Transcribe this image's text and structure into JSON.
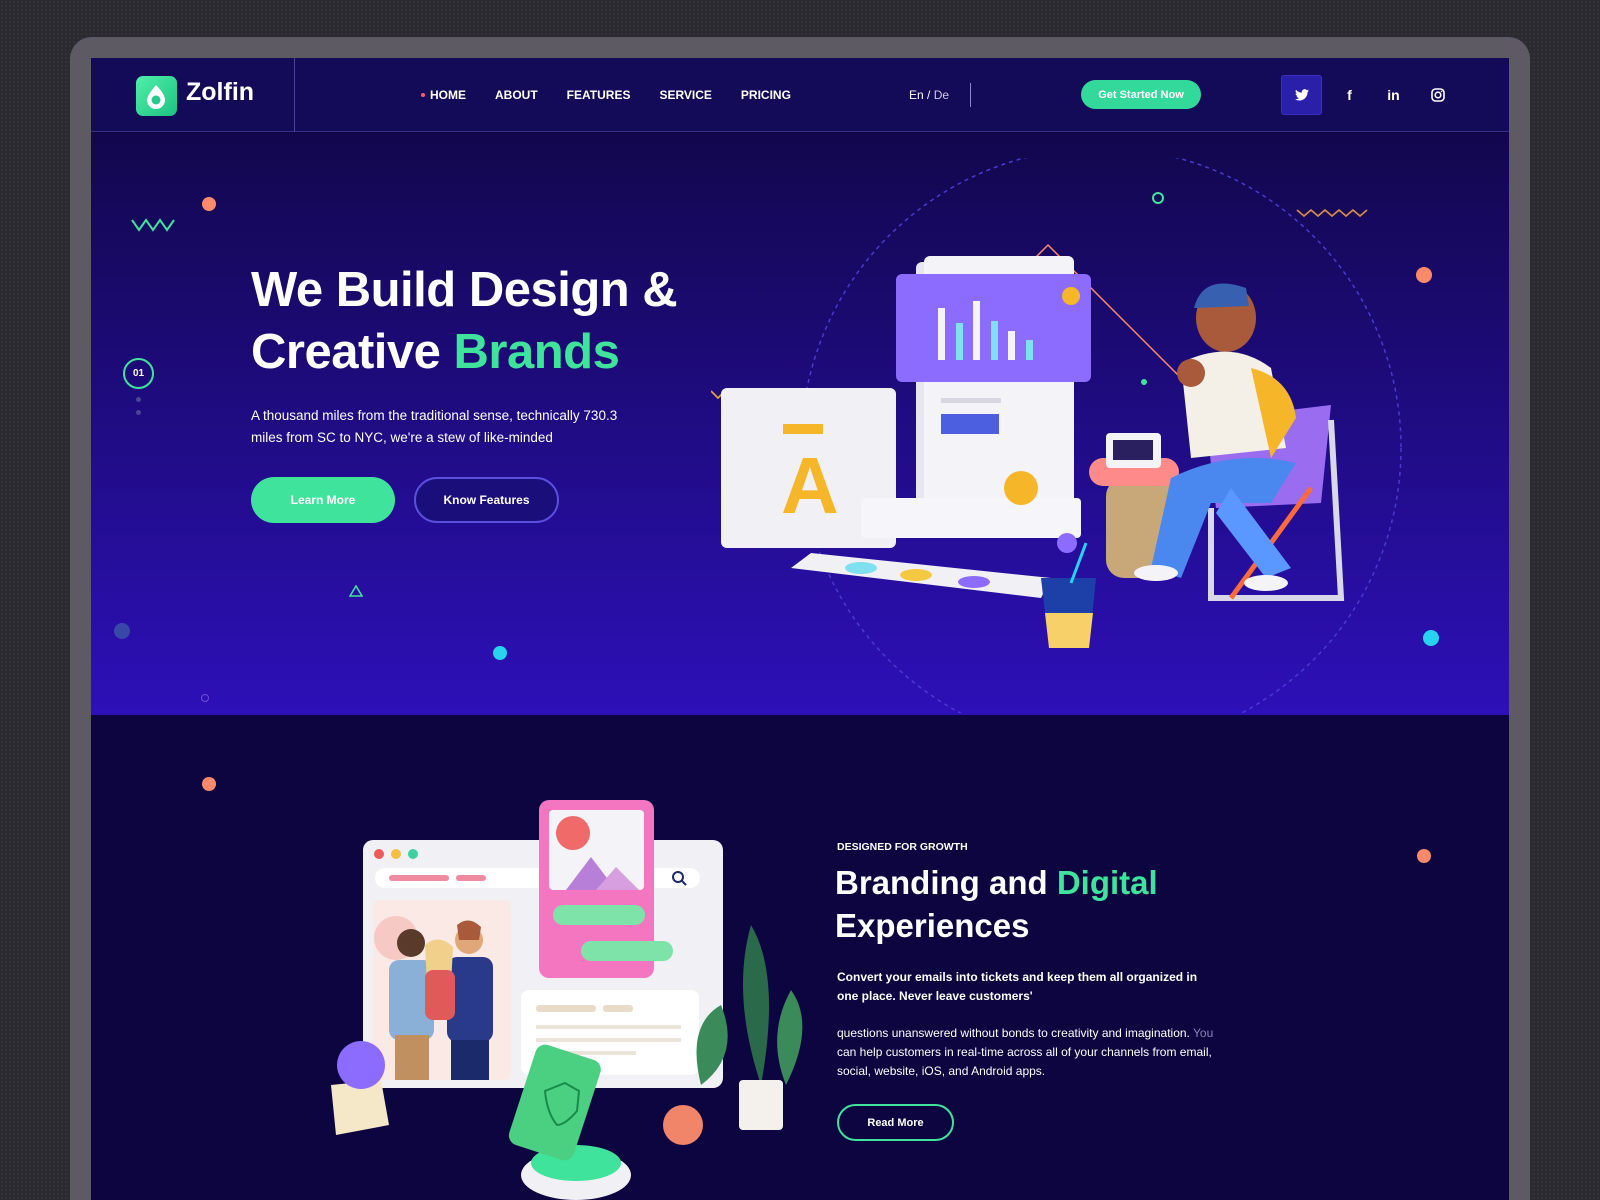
{
  "brand": {
    "name": "Zolfin"
  },
  "nav": {
    "items": [
      {
        "label": "HOME",
        "active": true
      },
      {
        "label": "ABOUT"
      },
      {
        "label": "FEATURES"
      },
      {
        "label": "SERVICE"
      },
      {
        "label": "PRICING"
      }
    ]
  },
  "lang": {
    "current": "En",
    "separator": "/",
    "other": "De"
  },
  "header": {
    "cta_label": "Get Started Now"
  },
  "social": [
    {
      "icon": "twitter-icon",
      "glyph": "🐦",
      "active": true
    },
    {
      "icon": "facebook-icon",
      "glyph": "f"
    },
    {
      "icon": "linkedin-icon",
      "glyph": "in"
    },
    {
      "icon": "instagram-icon",
      "glyph": "◎"
    }
  ],
  "hero": {
    "title_line1": "We Build Design &",
    "title_line2_plain": "Creative ",
    "title_line2_accent": "Brands",
    "description": "A thousand miles from the traditional sense, technically 730.3 miles from SC to NYC, we're a stew of like-minded",
    "learn_more_label": "Learn More",
    "know_features_label": "Know Features",
    "slide_number": "01"
  },
  "section2": {
    "kicker": "DESIGNED FOR GROWTH",
    "title_plain": "Branding and ",
    "title_accent": "Digital",
    "title_line2": "Experiences",
    "lead": "Convert your emails into tickets and keep them all organized in one place. Never leave customers'",
    "body_main": "questions unanswered without bonds to creativity and imagination.",
    "body_muted": "You",
    "body_rest": "can help customers in real-time across all of your channels from email, social, website, iOS, and Android apps.",
    "read_more_label": "Read More"
  },
  "colors": {
    "accent": "#3fe39b",
    "hero_top": "#12074d",
    "hero_bottom": "#2d10b8",
    "section_bg": "#0c0540",
    "header_bg": "#130a58"
  }
}
